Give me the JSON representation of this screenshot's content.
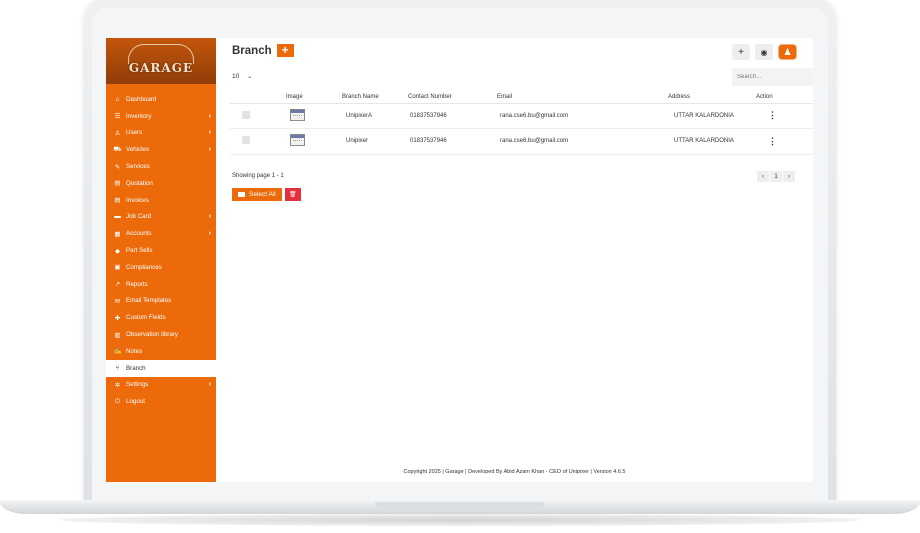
{
  "app": {
    "logo_text": "GARAGE"
  },
  "sidebar": {
    "items": [
      {
        "label": "Dashboard",
        "icon": "home-icon",
        "glyph": "⌂",
        "has_submenu": false,
        "active": false
      },
      {
        "label": "Inventory",
        "icon": "list-icon",
        "glyph": "☰",
        "has_submenu": true,
        "active": false
      },
      {
        "label": "Users",
        "icon": "user-icon",
        "glyph": "♙",
        "has_submenu": true,
        "active": false
      },
      {
        "label": "Vehicles",
        "icon": "car-icon",
        "glyph": "⛟",
        "has_submenu": true,
        "active": false
      },
      {
        "label": "Services",
        "icon": "wrench-icon",
        "glyph": "✎",
        "has_submenu": false,
        "active": false
      },
      {
        "label": "Quotation",
        "icon": "file-icon",
        "glyph": "▤",
        "has_submenu": false,
        "active": false
      },
      {
        "label": "Invoices",
        "icon": "invoice-icon",
        "glyph": "▤",
        "has_submenu": false,
        "active": false
      },
      {
        "label": "Job Card",
        "icon": "folder-icon",
        "glyph": "▬",
        "has_submenu": true,
        "active": false
      },
      {
        "label": "Accounts",
        "icon": "accounts-icon",
        "glyph": "▦",
        "has_submenu": true,
        "active": false
      },
      {
        "label": "Part Sells",
        "icon": "tag-icon",
        "glyph": "◆",
        "has_submenu": false,
        "active": false
      },
      {
        "label": "Compliances",
        "icon": "compliance-icon",
        "glyph": "▣",
        "has_submenu": false,
        "active": false
      },
      {
        "label": "Reports",
        "icon": "chart-icon",
        "glyph": "↗",
        "has_submenu": false,
        "active": false
      },
      {
        "label": "Email Templates",
        "icon": "envelope-icon",
        "glyph": "✉",
        "has_submenu": false,
        "active": false
      },
      {
        "label": "Custom Fields",
        "icon": "puzzle-icon",
        "glyph": "✚",
        "has_submenu": false,
        "active": false
      },
      {
        "label": "Observation library",
        "icon": "book-icon",
        "glyph": "▥",
        "has_submenu": false,
        "active": false
      },
      {
        "label": "Notes",
        "icon": "note-icon",
        "glyph": "✍",
        "has_submenu": false,
        "active": false
      },
      {
        "label": "Branch",
        "icon": "branch-icon",
        "glyph": "⑂",
        "has_submenu": false,
        "active": true
      },
      {
        "label": "Settings",
        "icon": "gear-icon",
        "glyph": "✲",
        "has_submenu": true,
        "active": false
      },
      {
        "label": "Logout",
        "icon": "power-icon",
        "glyph": "⏻",
        "has_submenu": false,
        "active": false
      }
    ]
  },
  "header": {
    "title": "Branch",
    "add_label": "+"
  },
  "toolbar": {
    "page_size": "10",
    "search_placeholder": "Search..."
  },
  "table": {
    "columns": [
      "",
      "Image",
      "Branch Name",
      "Contact Number",
      "Email",
      "Address",
      "Action"
    ],
    "rows": [
      {
        "branch_name": "UnipixerA",
        "contact": "01837537946",
        "email": "rana.cse6.bu@gmail.com",
        "address": "UTTAR KALARDONIA"
      },
      {
        "branch_name": "Unipixer",
        "contact": "01837537946",
        "email": "rana.cse6.bu@gmail.com",
        "address": "UTTAR KALARDONIA"
      }
    ]
  },
  "pagination": {
    "showing_text": "Showing page 1 - 1",
    "prev": "‹",
    "current": "1",
    "next": "›"
  },
  "bulk": {
    "select_all_label": "Select All"
  },
  "footer": {
    "text": "Copyright 2025 | Garage | Developed By Abid Azam Khan - CEO of Unipixer | Version 4.6.5"
  },
  "colors": {
    "accent": "#ec6a0a",
    "danger": "#e42f3c"
  }
}
